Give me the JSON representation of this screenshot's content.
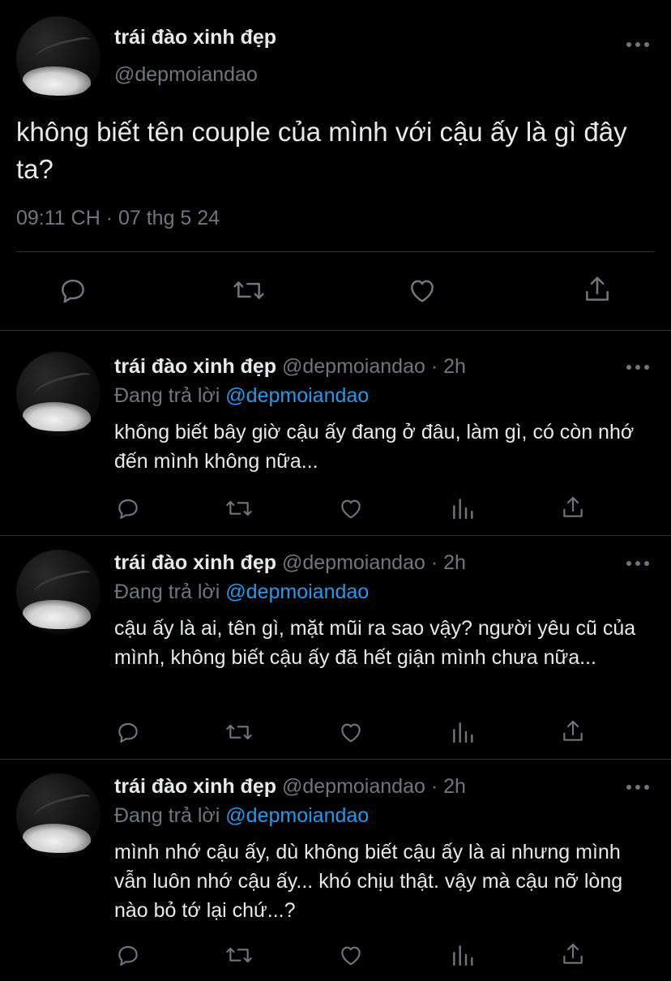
{
  "main": {
    "name": "trái đào xinh đẹp",
    "handle": "@depmoiandao",
    "text": "không biết tên couple của mình với cậu ấy là gì đây ta?",
    "timestamp": "09:11 CH · 07 thg 5 24"
  },
  "replies": [
    {
      "name": "trái đào xinh đẹp",
      "meta": "@depmoiandao · 2h",
      "replying_label": "Đang trả lời",
      "replying_to": "@depmoiandao",
      "text": "không biết bây giờ cậu ấy đang ở đâu, làm gì, có còn nhớ đến mình không nữa..."
    },
    {
      "name": "trái đào xinh đẹp",
      "meta": "@depmoiandao · 2h",
      "replying_label": "Đang trả lời",
      "replying_to": "@depmoiandao",
      "text": "cậu ấy là ai, tên gì, mặt mũi ra sao vậy? người yêu cũ của mình, không biết cậu ấy đã hết giận mình chưa nữa..."
    },
    {
      "name": "trái đào xinh đẹp",
      "meta": "@depmoiandao · 2h",
      "replying_label": "Đang trả lời",
      "replying_to": "@depmoiandao",
      "text": "mình nhớ cậu ấy, dù không biết cậu ấy là ai nhưng mình vẫn luôn nhớ cậu ấy... khó chịu thật. vậy mà cậu nỡ lòng nào bỏ tớ lại chứ...?"
    }
  ],
  "icons": {
    "reply": "reply-icon",
    "retweet": "retweet-icon",
    "like": "heart-icon",
    "views": "views-icon",
    "share": "share-icon",
    "more": "more-icon"
  },
  "colors": {
    "background": "#000000",
    "text": "#e7e9ea",
    "secondary": "#71767b",
    "accent": "#1d9bf0",
    "divider": "#2f3336"
  }
}
